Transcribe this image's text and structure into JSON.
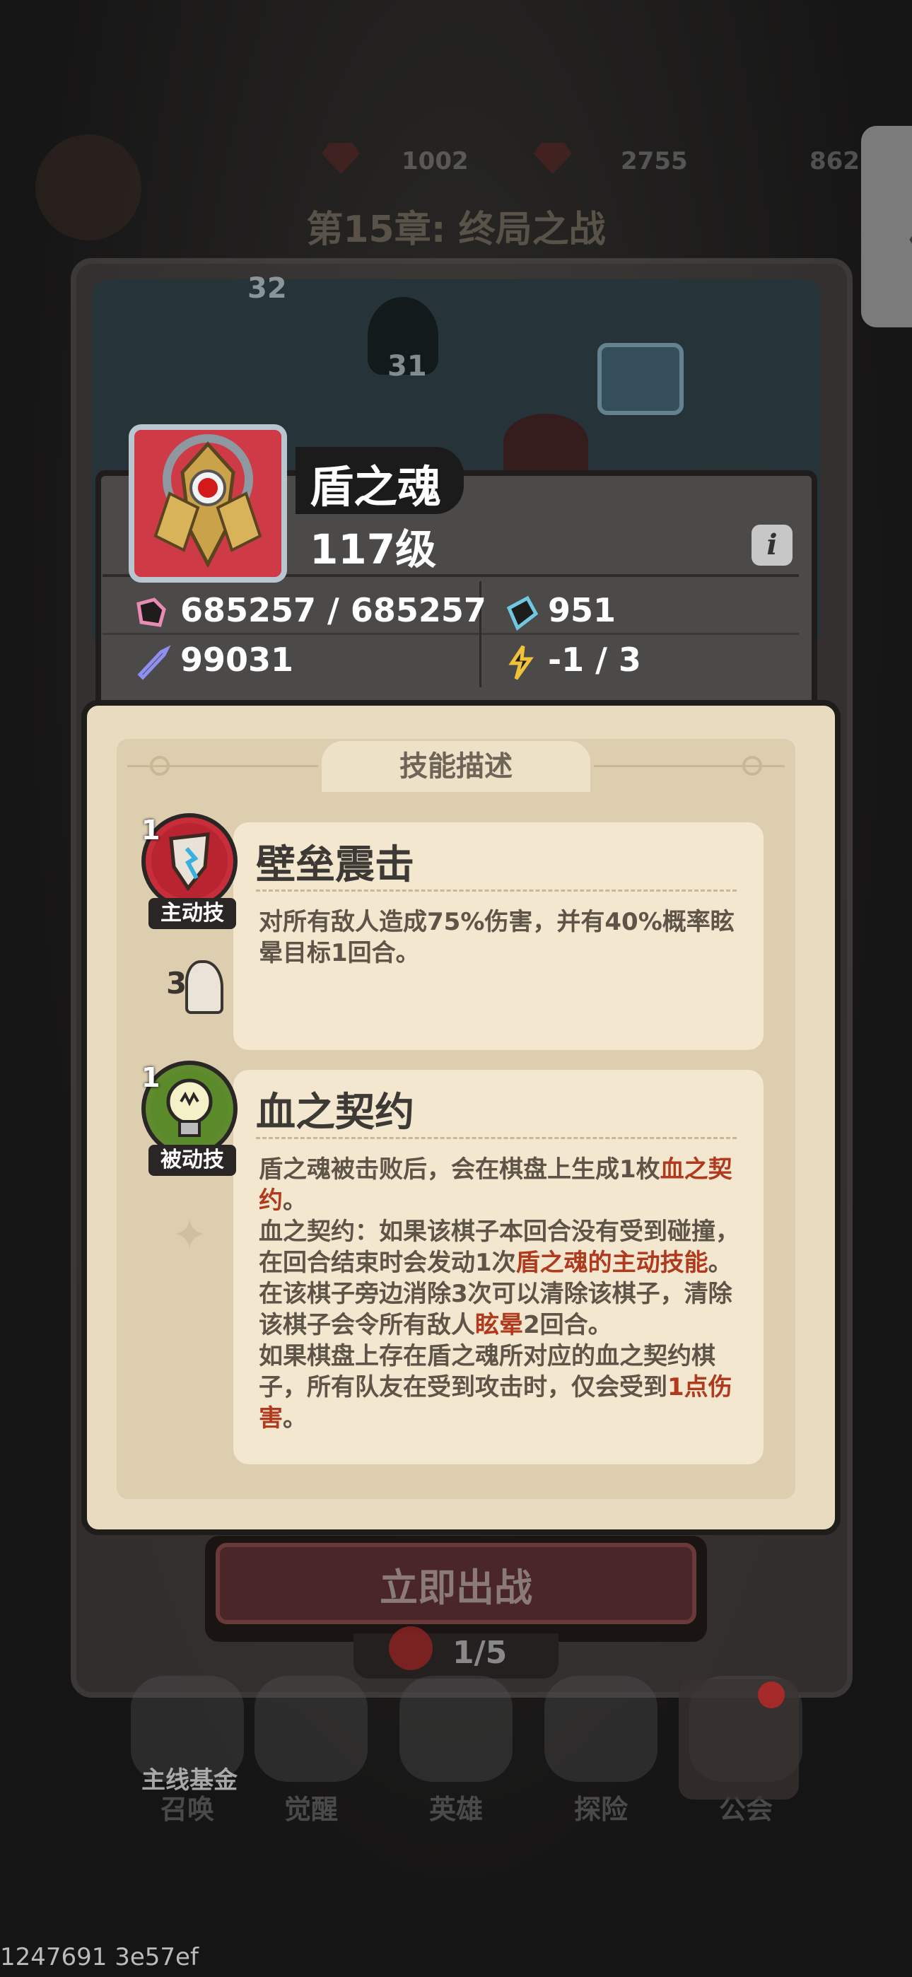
{
  "top_resources": {
    "gems": "1002",
    "rubies": "2755",
    "coins": "862"
  },
  "chapter_title": "第15章: 终局之战",
  "side_tab_glyph": "〈",
  "map": {
    "node_a": "32",
    "node_b": "31"
  },
  "hero": {
    "name": "盾之魂",
    "level": "117级",
    "info_glyph": "i",
    "hp": "685257 / 685257",
    "defense": "951",
    "attack": "99031",
    "energy": "-1 / 3"
  },
  "skill_panel": {
    "header": "技能描述",
    "active": {
      "level": "1",
      "type": "主动技",
      "name": "壁垒震击",
      "desc": "对所有敌人造成75%伤害，并有40%概率眩晕目标1回合。",
      "cost": "3"
    },
    "passive": {
      "level": "1",
      "type": "被动技",
      "name": "血之契约",
      "p1": "盾之魂被击败后，会在棋盘上生成1枚",
      "p1_hl": "血之契约",
      "p1_end": "。",
      "p2": "血之契约：如果该棋子本回合没有受到碰撞，在回合结束时会发动1次",
      "p2_hl": "盾之魂的主动技能",
      "p2_mid": "。在该棋子旁边消除3次可以清除该棋子，清除该棋子会令所有敌人",
      "p2_hl2": "眩晕",
      "p2_end": "2回合。",
      "p3": "如果棋盘上存在盾之魂所对应的血之契约棋子，所有队友在受到攻击时，仅会受到",
      "p3_hl": "1点伤害",
      "p3_end": "。"
    }
  },
  "battle_button": "立即出战",
  "stamina": "1/5",
  "bottom_nav": {
    "fund_label": "主线基金",
    "items": [
      "召唤",
      "觉醒",
      "英雄",
      "探险",
      "公会"
    ]
  },
  "footer_id": "1247691 3e57ef",
  "colors": {
    "highlight": "#b03a1e",
    "hero_portrait_bg": "#cf3a47"
  }
}
